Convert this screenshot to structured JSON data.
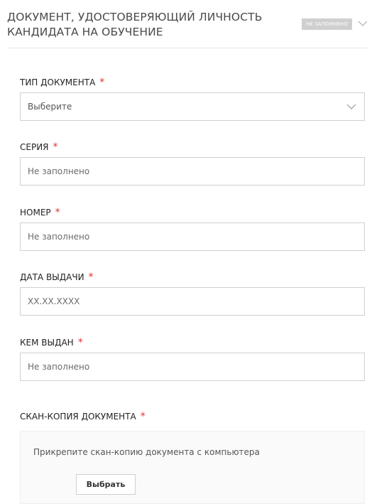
{
  "section": {
    "title": "ДОКУМЕНТ, УДОСТОВЕРЯЮЩИЙ ЛИЧНОСТЬ КАНДИДАТА НА ОБУЧЕНИЕ",
    "status": "НЕ ЗАПОЛНЕНО",
    "chevron_icon": "chevron-down-icon"
  },
  "required_mark": "*",
  "fields": {
    "doc_type": {
      "label": "ТИП ДОКУМЕНТА",
      "value": "Выберите",
      "icon": "chevron-down-icon"
    },
    "series": {
      "label": "СЕРИЯ",
      "placeholder": "Не заполнено"
    },
    "number": {
      "label": "НОМЕР",
      "placeholder": "Не заполнено"
    },
    "issue_date": {
      "label": "ДАТА ВЫДАЧИ",
      "placeholder": "XX.XX.XXXX"
    },
    "issued_by": {
      "label": "КЕМ ВЫДАН",
      "placeholder": "Не заполнено"
    }
  },
  "scan": {
    "label": "СКАН-КОПИЯ ДОКУМЕНТА",
    "hint": "Прикрепите скан-копию документа с компьютера",
    "button_label": "Выбрать"
  },
  "colors": {
    "required": "#e0312f",
    "badge_bg": "#cfcfcf",
    "border": "#d0d0d0"
  }
}
